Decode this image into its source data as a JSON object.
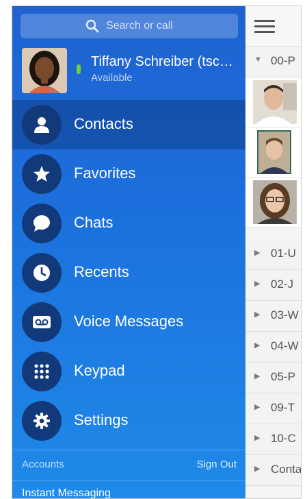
{
  "search": {
    "placeholder": "Search or call"
  },
  "profile": {
    "name": "Tiffany Schreiber (tsc…",
    "status": "Available"
  },
  "nav": [
    {
      "label": "Contacts",
      "icon": "person-icon"
    },
    {
      "label": "Favorites",
      "icon": "star-icon"
    },
    {
      "label": "Chats",
      "icon": "chat-bubble-icon"
    },
    {
      "label": "Recents",
      "icon": "clock-icon"
    },
    {
      "label": "Voice Messages",
      "icon": "voicemail-icon"
    },
    {
      "label": "Keypad",
      "icon": "keypad-icon"
    },
    {
      "label": "Settings",
      "icon": "gear-icon"
    }
  ],
  "footer": {
    "accounts_label": "Accounts",
    "sign_out_label": "Sign Out",
    "instant_messaging_label": "Instant Messaging"
  },
  "contact_groups": [
    {
      "label": "00-P",
      "expanded": true
    },
    {
      "label": "01-U",
      "expanded": false
    },
    {
      "label": "02-J",
      "expanded": false
    },
    {
      "label": "03-W",
      "expanded": false
    },
    {
      "label": "04-W",
      "expanded": false
    },
    {
      "label": "05-P",
      "expanded": false
    },
    {
      "label": "09-T",
      "expanded": false
    },
    {
      "label": "10-C",
      "expanded": false
    },
    {
      "label": "Conta",
      "expanded": false
    }
  ],
  "colors": {
    "drawer_top": "#1f62cf",
    "drawer_bottom": "#1f8ae8",
    "nav_circle": "#12397a",
    "presence_available": "#6ad23a"
  }
}
